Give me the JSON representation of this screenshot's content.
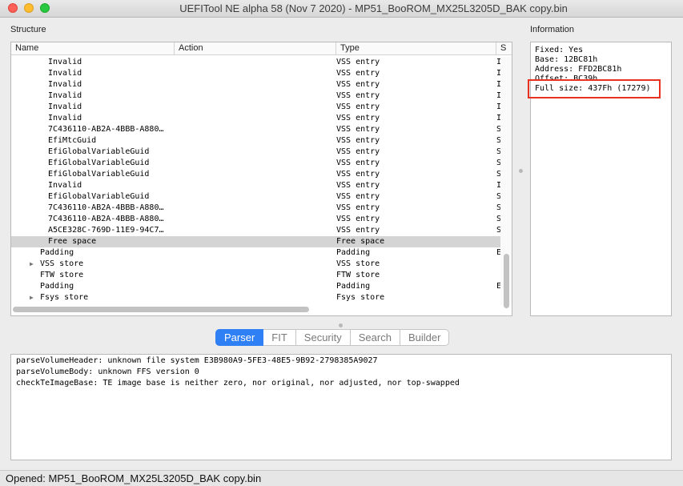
{
  "window": {
    "title": "UEFITool NE alpha 58 (Nov  7 2020) - MP51_BooROM_MX25L3205D_BAK copy.bin"
  },
  "structure": {
    "label": "Structure",
    "columns": {
      "name": "Name",
      "action": "Action",
      "type": "Type",
      "subtype": "S"
    },
    "rows": [
      {
        "name": "Invalid",
        "action": "",
        "type": "VSS entry",
        "subtype": "I",
        "indent": 2,
        "expandable": false,
        "selected": false
      },
      {
        "name": "Invalid",
        "action": "",
        "type": "VSS entry",
        "subtype": "I",
        "indent": 2,
        "expandable": false,
        "selected": false
      },
      {
        "name": "Invalid",
        "action": "",
        "type": "VSS entry",
        "subtype": "I",
        "indent": 2,
        "expandable": false,
        "selected": false
      },
      {
        "name": "Invalid",
        "action": "",
        "type": "VSS entry",
        "subtype": "I",
        "indent": 2,
        "expandable": false,
        "selected": false
      },
      {
        "name": "Invalid",
        "action": "",
        "type": "VSS entry",
        "subtype": "I",
        "indent": 2,
        "expandable": false,
        "selected": false
      },
      {
        "name": "Invalid",
        "action": "",
        "type": "VSS entry",
        "subtype": "I",
        "indent": 2,
        "expandable": false,
        "selected": false
      },
      {
        "name": "7C436110-AB2A-4BBB-A880…",
        "action": "",
        "type": "VSS entry",
        "subtype": "S",
        "indent": 2,
        "expandable": false,
        "selected": false
      },
      {
        "name": "EfiMtcGuid",
        "action": "",
        "type": "VSS entry",
        "subtype": "S",
        "indent": 2,
        "expandable": false,
        "selected": false
      },
      {
        "name": "EfiGlobalVariableGuid",
        "action": "",
        "type": "VSS entry",
        "subtype": "S",
        "indent": 2,
        "expandable": false,
        "selected": false
      },
      {
        "name": "EfiGlobalVariableGuid",
        "action": "",
        "type": "VSS entry",
        "subtype": "S",
        "indent": 2,
        "expandable": false,
        "selected": false
      },
      {
        "name": "EfiGlobalVariableGuid",
        "action": "",
        "type": "VSS entry",
        "subtype": "S",
        "indent": 2,
        "expandable": false,
        "selected": false
      },
      {
        "name": "Invalid",
        "action": "",
        "type": "VSS entry",
        "subtype": "I",
        "indent": 2,
        "expandable": false,
        "selected": false
      },
      {
        "name": "EfiGlobalVariableGuid",
        "action": "",
        "type": "VSS entry",
        "subtype": "S",
        "indent": 2,
        "expandable": false,
        "selected": false
      },
      {
        "name": "7C436110-AB2A-4BBB-A880…",
        "action": "",
        "type": "VSS entry",
        "subtype": "S",
        "indent": 2,
        "expandable": false,
        "selected": false
      },
      {
        "name": "7C436110-AB2A-4BBB-A880…",
        "action": "",
        "type": "VSS entry",
        "subtype": "S",
        "indent": 2,
        "expandable": false,
        "selected": false
      },
      {
        "name": "A5CE328C-769D-11E9-94C7…",
        "action": "",
        "type": "VSS entry",
        "subtype": "S",
        "indent": 2,
        "expandable": false,
        "selected": false
      },
      {
        "name": "Free space",
        "action": "",
        "type": "Free space",
        "subtype": "",
        "indent": 2,
        "expandable": false,
        "selected": true
      },
      {
        "name": "Padding",
        "action": "",
        "type": "Padding",
        "subtype": "E",
        "indent": 1,
        "expandable": false,
        "selected": false
      },
      {
        "name": "VSS store",
        "action": "",
        "type": "VSS store",
        "subtype": "",
        "indent": 1,
        "expandable": true,
        "selected": false
      },
      {
        "name": "FTW store",
        "action": "",
        "type": "FTW store",
        "subtype": "",
        "indent": 1,
        "expandable": false,
        "selected": false
      },
      {
        "name": "Padding",
        "action": "",
        "type": "Padding",
        "subtype": "E",
        "indent": 1,
        "expandable": false,
        "selected": false
      },
      {
        "name": "Fsys store",
        "action": "",
        "type": "Fsys store",
        "subtype": "",
        "indent": 1,
        "expandable": true,
        "selected": false
      }
    ]
  },
  "information": {
    "label": "Information",
    "lines": [
      "Fixed: Yes",
      "Base: 12BC81h",
      "Address: FFD2BC81h",
      "Offset: BC39h",
      "Full size: 437Fh (17279)"
    ]
  },
  "tabs": [
    {
      "label": "Parser",
      "active": true
    },
    {
      "label": "FIT",
      "active": false
    },
    {
      "label": "Security",
      "active": false
    },
    {
      "label": "Search",
      "active": false
    },
    {
      "label": "Builder",
      "active": false
    }
  ],
  "log": [
    "parseVolumeHeader: unknown file system E3B980A9-5FE3-48E5-9B92-2798385A9027",
    "parseVolumeBody: unknown FFS version 0",
    "checkTeImageBase: TE image base is neither zero, nor original, nor adjusted, nor top-swapped"
  ],
  "status": {
    "text": "Opened: MP51_BooROM_MX25L3205D_BAK copy.bin"
  },
  "colors": {
    "accent": "#2f7ff5",
    "highlight": "#e8321f",
    "selection": "#d4d4d4"
  }
}
